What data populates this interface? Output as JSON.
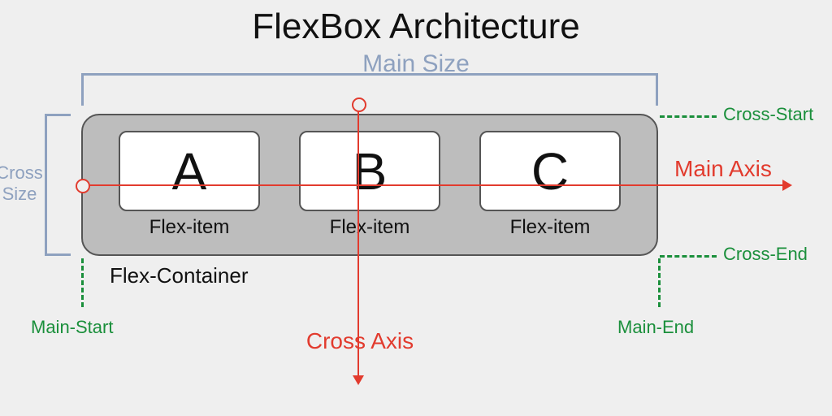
{
  "title": "FlexBox Architecture",
  "mainSize": "Main Size",
  "crossSize": "Cross Size",
  "crossStart": "Cross-Start",
  "crossEnd": "Cross-End",
  "mainStart": "Main-Start",
  "mainEnd": "Main-End",
  "mainAxis": "Main Axis",
  "crossAxis": "Cross Axis",
  "flexContainer": "Flex-Container",
  "flexItemLabel": "Flex-item",
  "items": {
    "a": "A",
    "b": "B",
    "c": "C"
  },
  "colors": {
    "bracket": "#8ea1bf",
    "axis": "#e23b2e",
    "marker": "#1a8f3b"
  }
}
